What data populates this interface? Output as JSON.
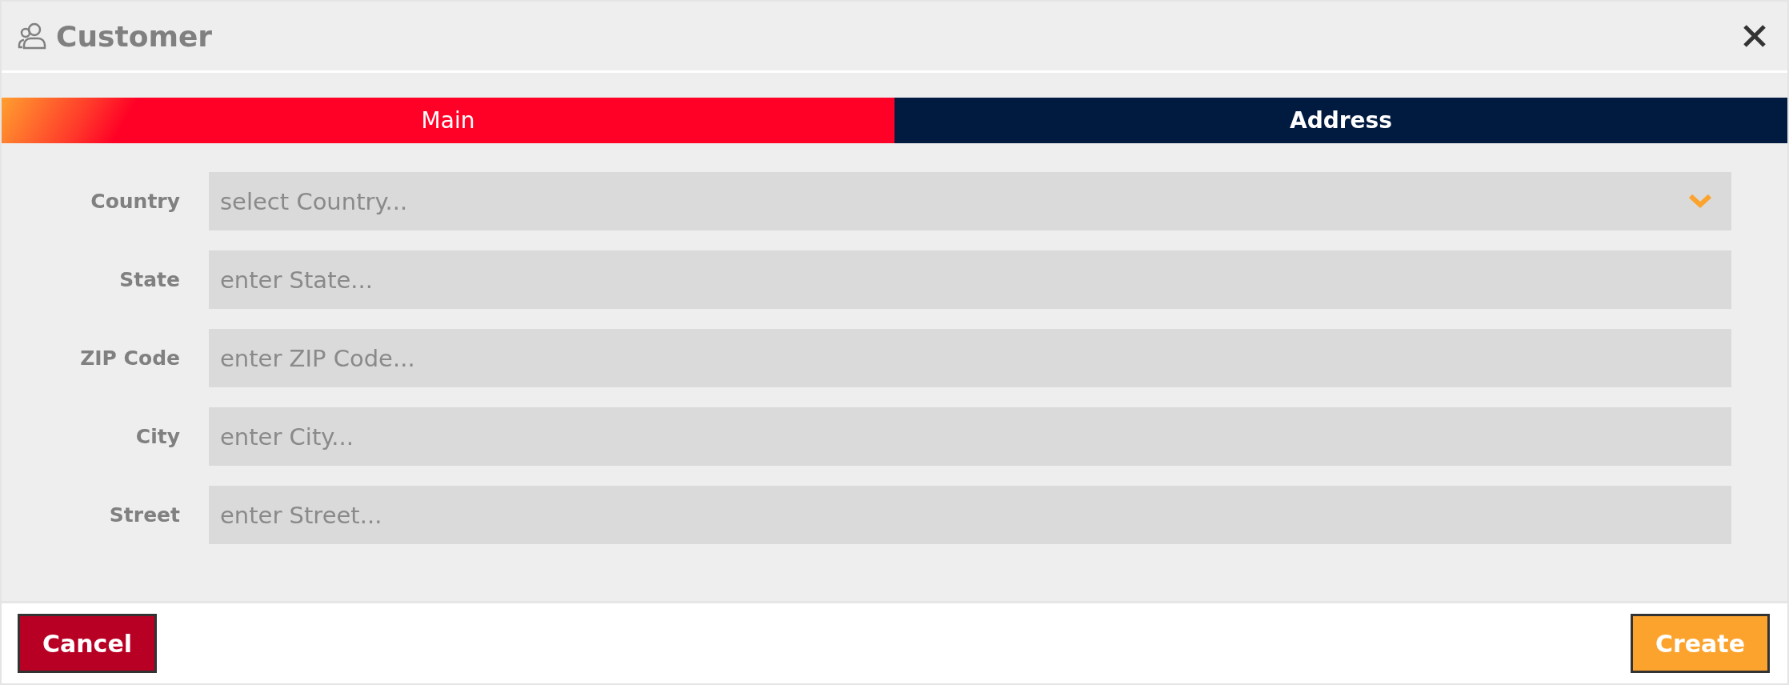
{
  "dialog": {
    "title": "Customer"
  },
  "tabs": [
    {
      "label": "Main",
      "selected": true
    },
    {
      "label": "Address",
      "selected": false
    }
  ],
  "fields": [
    {
      "kind": "select",
      "label": "Country",
      "placeholder": "select Country..."
    },
    {
      "kind": "text",
      "label": "State",
      "placeholder": "enter State..."
    },
    {
      "kind": "text",
      "label": "ZIP Code",
      "placeholder": "enter ZIP Code..."
    },
    {
      "kind": "text",
      "label": "City",
      "placeholder": "enter City..."
    },
    {
      "kind": "text",
      "label": "Street",
      "placeholder": "enter Street..."
    }
  ],
  "buttons": [
    {
      "kind": "cancel",
      "label": "Cancel"
    },
    {
      "kind": "primary",
      "label": "Create"
    }
  ]
}
